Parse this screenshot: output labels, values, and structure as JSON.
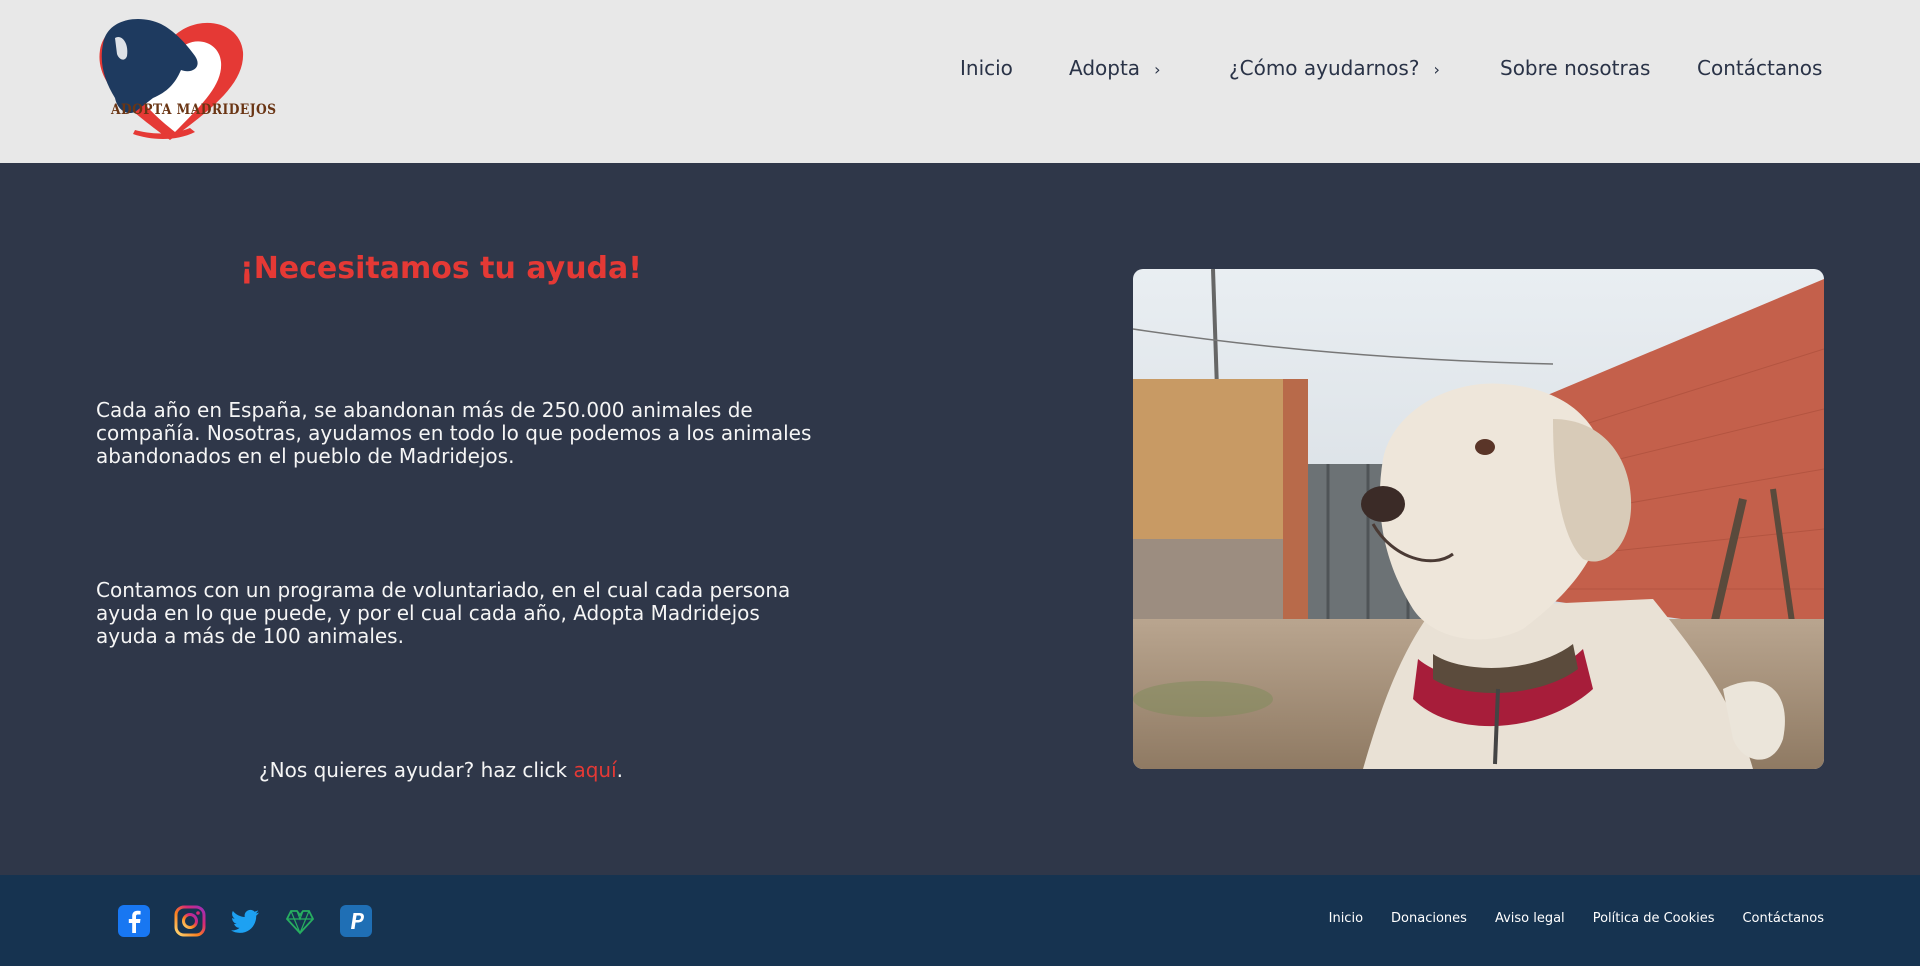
{
  "brand": {
    "logo_text": "ADOPTA MADRIDEJOS"
  },
  "nav": {
    "items": [
      {
        "label": "Inicio"
      },
      {
        "label": "Adopta"
      },
      {
        "label": "¿Cómo ayudarnos?"
      },
      {
        "label": "Sobre nosotras"
      },
      {
        "label": "Contáctanos"
      }
    ]
  },
  "main": {
    "title": "¡Necesitamos tu ayuda!",
    "paragraph1": "Cada año en España, se abandonan más de 250.000 animales de compañía. Nosotras, ayudamos en todo lo que podemos a los animales abandonados en el pueblo de Madridejos.",
    "paragraph2": "Contamos con un programa de voluntariado, en el cual cada persona ayuda en lo que puede, y por el cual cada año, Adopta Madridejos ayuda a más de 100 animales.",
    "cta_prefix": "¿Nos quieres ayudar? haz click ",
    "cta_link": "aquí",
    "cta_suffix": "."
  },
  "footer": {
    "social": [
      "facebook-icon",
      "instagram-icon",
      "twitter-icon",
      "heart-network-icon",
      "paypal-icon"
    ],
    "links": [
      {
        "label": "Inicio"
      },
      {
        "label": "Donaciones"
      },
      {
        "label": "Aviso legal"
      },
      {
        "label": "Política de Cookies"
      },
      {
        "label": "Contáctanos"
      }
    ]
  },
  "colors": {
    "accent": "#e53935",
    "header_bg": "#e8e8e8",
    "main_bg": "#2f3749",
    "footer_bg": "#163350"
  }
}
